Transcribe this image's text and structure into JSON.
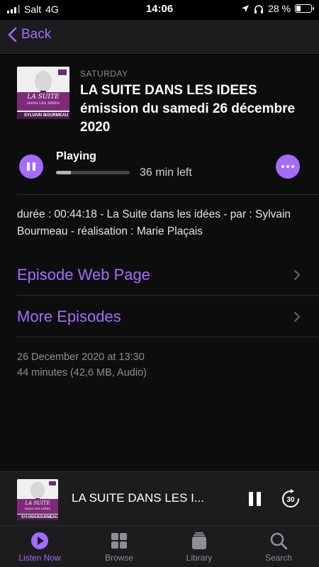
{
  "status_bar": {
    "carrier": "Salt",
    "network": "4G",
    "time": "14:06",
    "battery": "28 %",
    "battery_level": 0.28
  },
  "nav": {
    "back_label": "Back"
  },
  "episode": {
    "artwork": {
      "brand": "culture",
      "show": "LA SUITE",
      "subtitle": "DANS LES IDÉES",
      "host_first": "SYLVAIN",
      "host_last": "BOURMEAU"
    },
    "day": "SATURDAY",
    "title": "LA SUITE DANS LES IDEES émission du samedi 26 décembre 2020",
    "status": "Playing",
    "progress": 0.2,
    "time_left": "36 min left",
    "description": "durée : 00:44:18 - La Suite dans les idées - par : Sylvain Bourmeau - réalisation : Marie Plaçais",
    "links": [
      "Episode Web Page",
      "More Episodes"
    ],
    "date": "26 December 2020 at 13:30",
    "details": "44 minutes (42,6 MB, Audio)"
  },
  "mini_player": {
    "title": "LA SUITE DANS LES I...",
    "skip_label": "30"
  },
  "tabs": [
    {
      "label": "Listen Now",
      "icon": "play-circle-icon",
      "active": true
    },
    {
      "label": "Browse",
      "icon": "grid-icon",
      "active": false
    },
    {
      "label": "Library",
      "icon": "stack-icon",
      "active": false
    },
    {
      "label": "Search",
      "icon": "search-icon",
      "active": false
    }
  ],
  "colors": {
    "accent": "#a56bff",
    "background": "#000000",
    "bar_background": "#1c1c1e",
    "artwork_band": "#7d2a78"
  }
}
